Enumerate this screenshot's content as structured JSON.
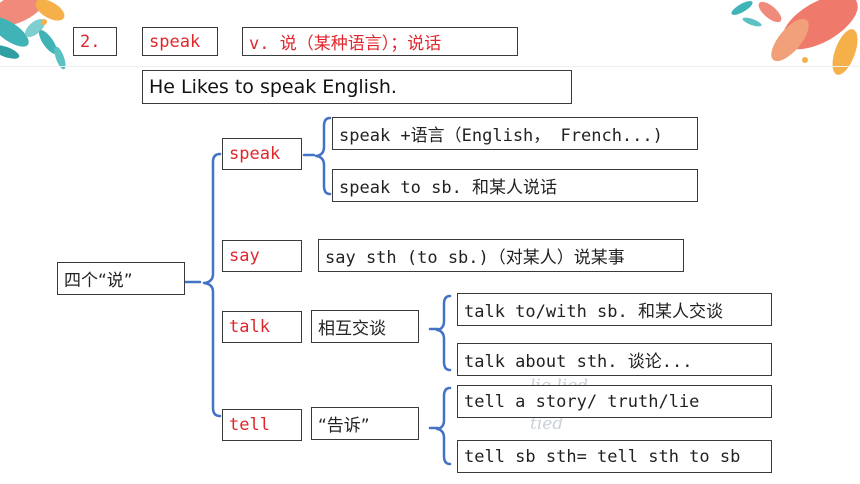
{
  "row1": {
    "number": "2.",
    "word": "speak",
    "definition": "v. 说（某种语言）；说话"
  },
  "example": "He Likes to speak English.",
  "root": "四个“说”",
  "branches": {
    "speak": {
      "label": "speak",
      "usages": [
        "speak +语言（English， French...)",
        "speak to sb. 和某人说话"
      ]
    },
    "say": {
      "label": "say",
      "usage": "say sth (to sb.)（对某人）说某事"
    },
    "talk": {
      "label": "talk",
      "meaning": "相互交谈",
      "usages": [
        "talk to/with sb. 和某人交谈",
        "talk about sth. 谈论..."
      ]
    },
    "tell": {
      "label": "tell",
      "meaning": "“告诉”",
      "usages": [
        "tell a story/  truth/lie",
        "tell sb sth= tell sth to sb"
      ]
    }
  },
  "faint_text": {
    "line1": "lie    lied",
    "line2": "tied"
  },
  "colors": {
    "red": "#e0262b",
    "bracket_blue": "#4472c4",
    "border": "#3a3a3a"
  }
}
